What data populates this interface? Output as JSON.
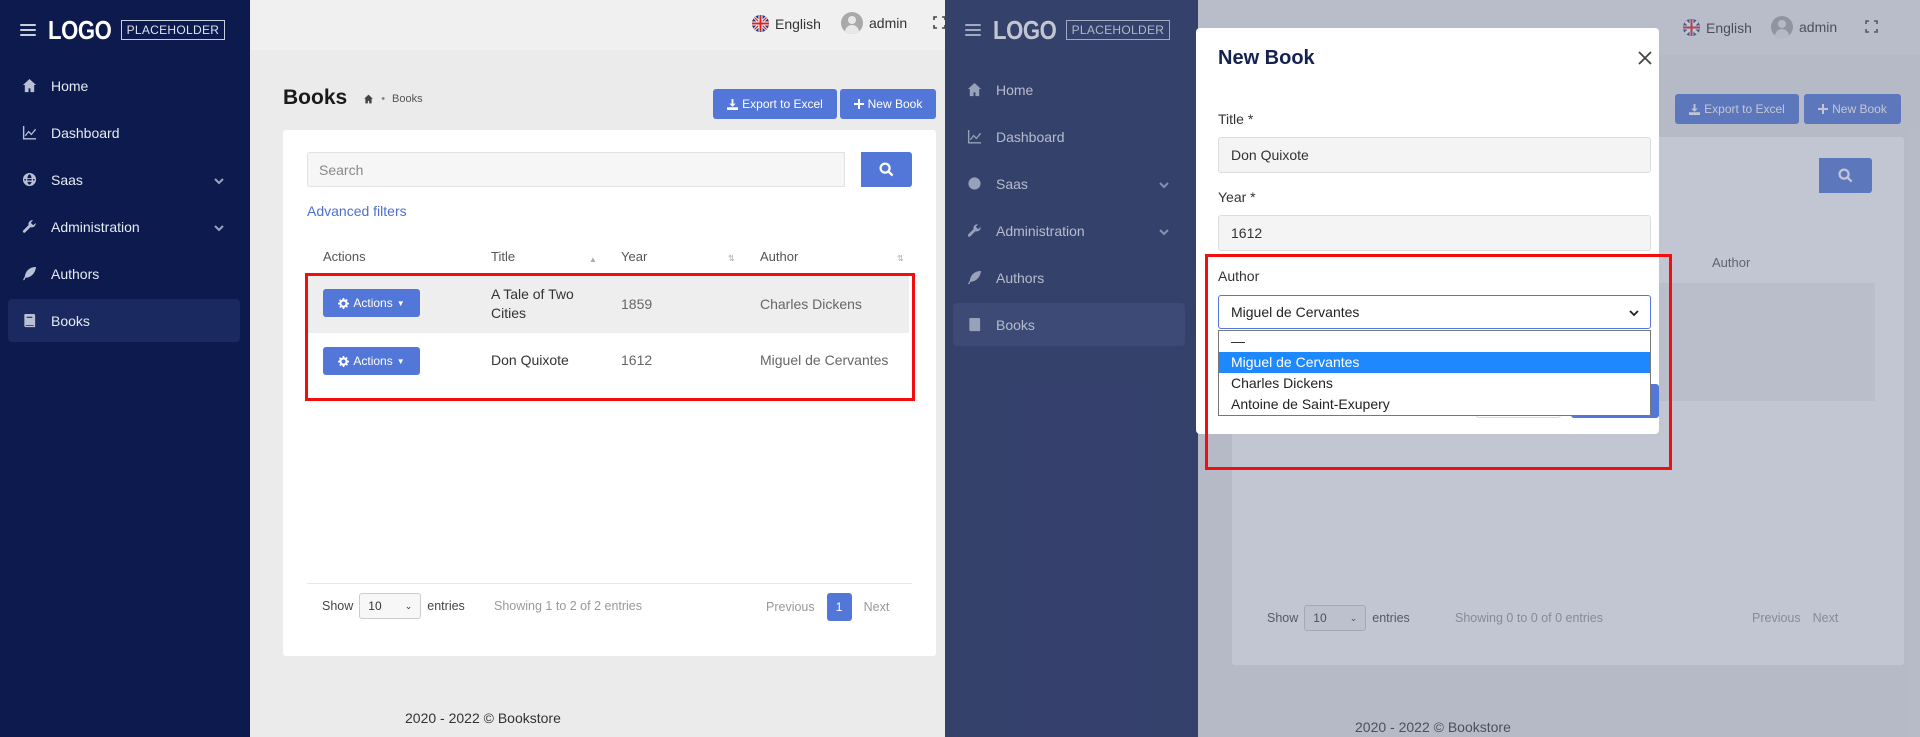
{
  "app": {
    "logo_main": "LOGO",
    "logo_sub": "PLACEHOLDER",
    "language": "English",
    "user": "admin",
    "footer": "2020 - 2022 © Bookstore"
  },
  "sidebar": {
    "items": [
      {
        "label": "Home",
        "icon": "home-icon"
      },
      {
        "label": "Dashboard",
        "icon": "chart-icon"
      },
      {
        "label": "Saas",
        "icon": "globe-icon",
        "expandable": true
      },
      {
        "label": "Administration",
        "icon": "wrench-icon",
        "expandable": true
      },
      {
        "label": "Authors",
        "icon": "feather-icon"
      },
      {
        "label": "Books",
        "icon": "book-icon",
        "active": true
      }
    ]
  },
  "page": {
    "title": "Books",
    "breadcrumb_current": "Books",
    "export_label": "Export to Excel",
    "new_label": "New Book",
    "search_placeholder": "Search",
    "advanced_filters": "Advanced filters"
  },
  "table": {
    "columns": [
      "Actions",
      "Title",
      "Year",
      "Author"
    ],
    "action_label": "Actions",
    "rows": [
      {
        "title": "A Tale of Two Cities",
        "year": "1859",
        "author": "Charles Dickens"
      },
      {
        "title": "Don Quixote",
        "year": "1612",
        "author": "Miguel de Cervantes"
      }
    ],
    "show_label": "Show",
    "page_size": "10",
    "entries_label": "entries",
    "info": "Showing 1 to 2 of 2 entries",
    "prev": "Previous",
    "page": "1",
    "next": "Next"
  },
  "right_background": {
    "info": "Showing 0 to 0 of 0 entries"
  },
  "modal": {
    "title": "New Book",
    "title_label": "Title *",
    "title_value": "Don Quixote",
    "year_label": "Year *",
    "year_value": "1612",
    "author_label": "Author",
    "author_value": "Miguel de Cervantes",
    "options": [
      "—",
      "Miguel de Cervantes",
      "Charles Dickens",
      "Antoine de Saint-Exupery"
    ],
    "selected_index": 1
  },
  "colors": {
    "sidebar": "#0c1a4d",
    "accent": "#5277d9",
    "highlight": "#f20e0e",
    "option_selected": "#1e88ff"
  }
}
